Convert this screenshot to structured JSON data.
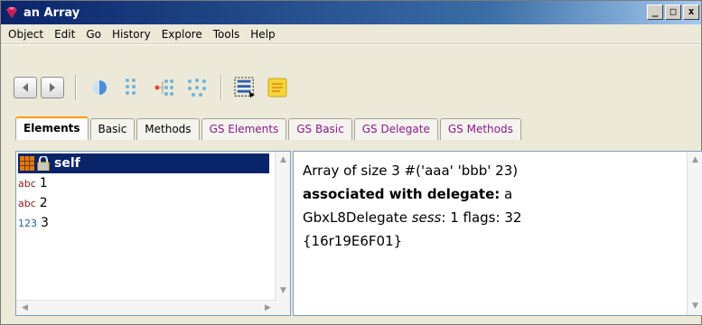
{
  "window": {
    "title": "an Array",
    "controls": {
      "minimize": "_",
      "maximize": "□",
      "close": "x"
    }
  },
  "menu": [
    {
      "label": "Object"
    },
    {
      "label": "Edit"
    },
    {
      "label": "Go"
    },
    {
      "label": "History"
    },
    {
      "label": "Explore"
    },
    {
      "label": "Tools"
    },
    {
      "label": "Help"
    }
  ],
  "toolbar": {
    "icons": [
      "back-icon",
      "forward-icon",
      "half-circle-icon",
      "dot-grid-icon",
      "branch-icon",
      "network-icon",
      "list-selection-icon",
      "notepad-icon"
    ]
  },
  "tabs": [
    {
      "label": "Elements",
      "active": true
    },
    {
      "label": "Basic"
    },
    {
      "label": "Methods"
    },
    {
      "label": "GS Elements"
    },
    {
      "label": "GS Basic"
    },
    {
      "label": "GS Delegate"
    },
    {
      "label": "GS Methods"
    }
  ],
  "elements": [
    {
      "tag": "",
      "label": "self",
      "selected": true
    },
    {
      "tag": "abc",
      "label": "1"
    },
    {
      "tag": "abc",
      "label": "2"
    },
    {
      "tag": "123",
      "label": "3"
    }
  ],
  "details": {
    "line1": "Array of size 3 #('aaa' 'bbb' 23)",
    "line2_bold": "associated with delegate:",
    "line2_rest": "a",
    "line3_pre": "GbxL8Delegate",
    "line3_italic": "sess",
    "line3_rest": ": 1 flags: 32",
    "line4": "{16r19E6F01}"
  },
  "colors": {
    "titlebar": "#0a246a",
    "selection": "#0a246a",
    "active_tab_accent": "#ff9a00",
    "gs_tab_text": "#8b1a8b"
  }
}
